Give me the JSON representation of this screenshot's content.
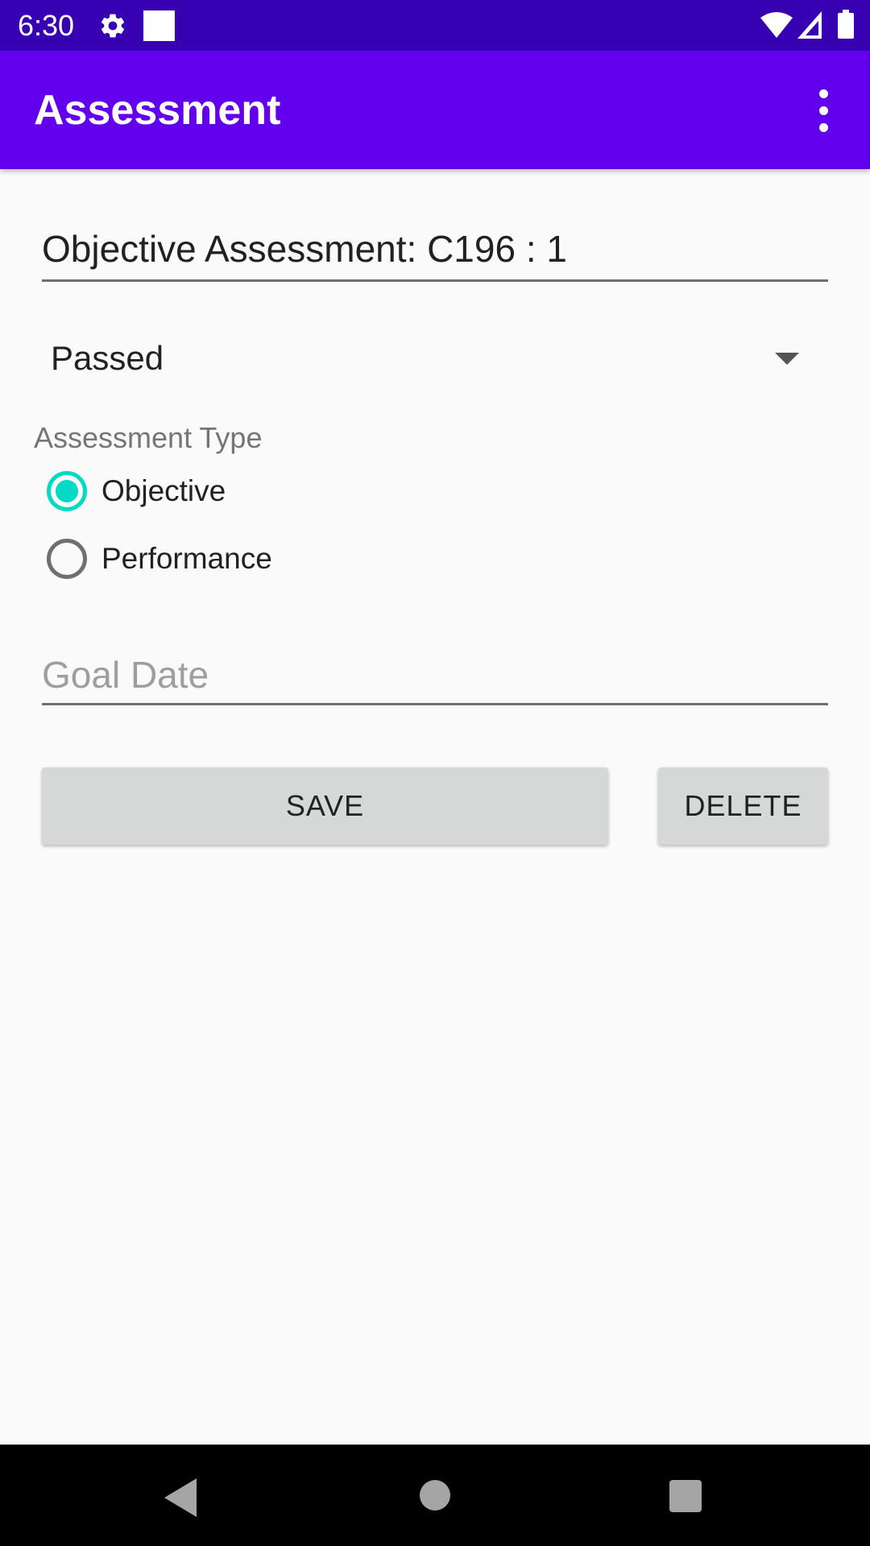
{
  "status_bar": {
    "time": "6:30",
    "icons": [
      "gear-icon",
      "square-icon",
      "wifi-icon",
      "signal-icon",
      "battery-icon"
    ]
  },
  "app_bar": {
    "title": "Assessment",
    "overflow_icon": "more-vert-icon",
    "color": "#6200ee"
  },
  "form": {
    "title_value": "Objective Assessment: C196 : 1",
    "status_spinner": {
      "selected": "Passed"
    },
    "type_section_label": "Assessment Type",
    "type_options": [
      {
        "label": "Objective",
        "checked": true
      },
      {
        "label": "Performance",
        "checked": false
      }
    ],
    "goal_date": {
      "value": "",
      "placeholder": "Goal Date"
    },
    "save_label": "SAVE",
    "delete_label": "DELETE",
    "accent_color": "#03dac5"
  },
  "nav_bar": {
    "icons": [
      "back-icon",
      "home-icon",
      "recents-icon"
    ]
  }
}
